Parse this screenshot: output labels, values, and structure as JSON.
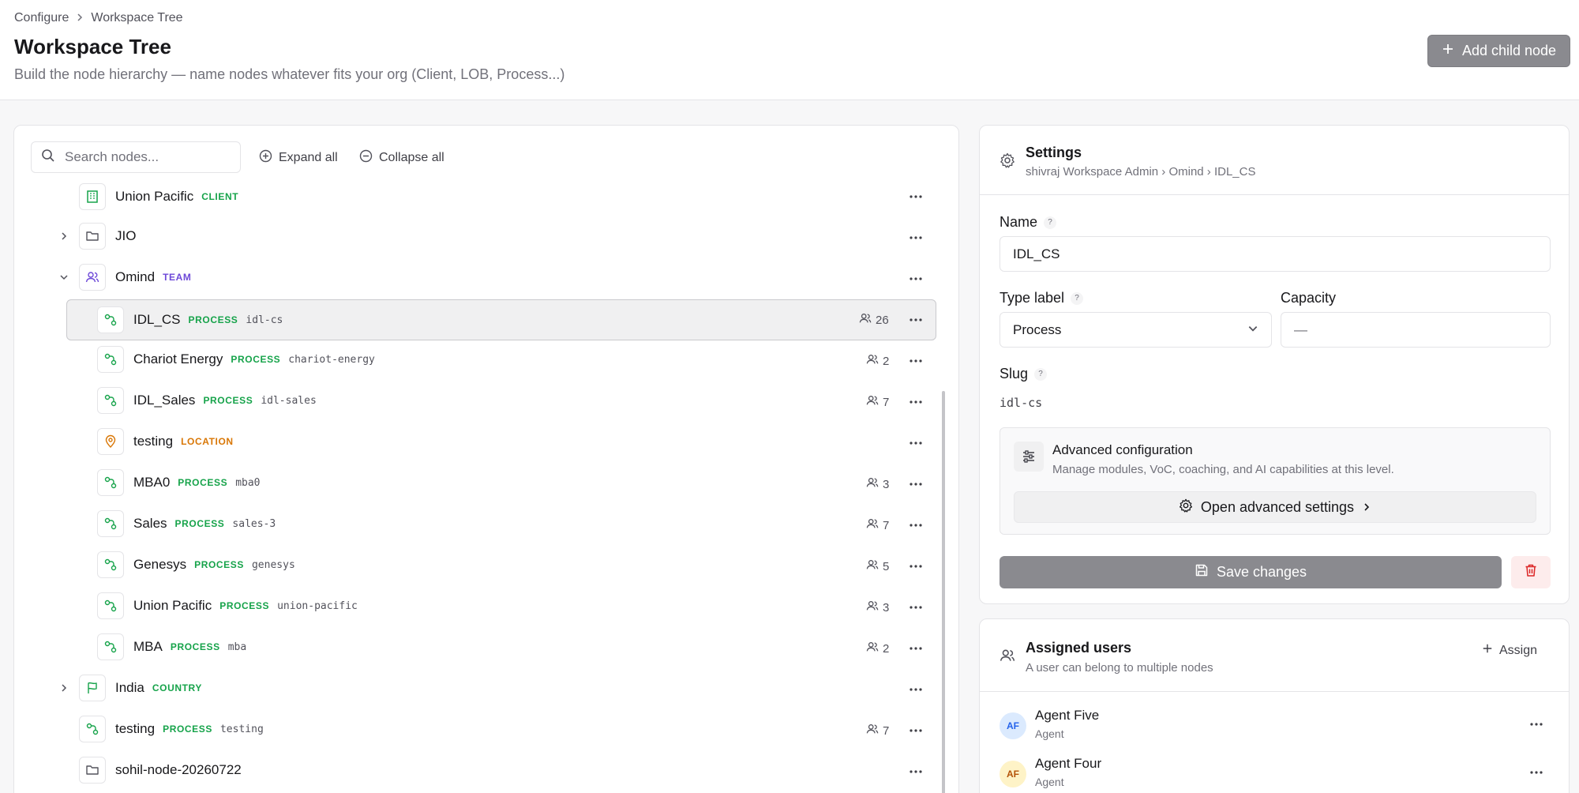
{
  "header": {
    "breadcrumb": [
      "Configure",
      "Workspace Tree"
    ],
    "title": "Workspace Tree",
    "subtitle": "Build the node hierarchy — name nodes whatever fits your org (Client, LOB, Process...)",
    "add_child_label": "Add child node"
  },
  "tree": {
    "search_placeholder": "Search nodes...",
    "expand_all": "Expand all",
    "collapse_all": "Collapse all",
    "nodes": [
      {
        "name": "Union Pacific",
        "type": "CLIENT",
        "slug": "",
        "count": ""
      },
      {
        "name": "JIO",
        "type": "",
        "slug": "",
        "count": ""
      },
      {
        "name": "Omind",
        "type": "TEAM",
        "slug": "",
        "count": ""
      },
      {
        "name": "IDL_CS",
        "type": "PROCESS",
        "slug": "idl-cs",
        "count": "26"
      },
      {
        "name": "Chariot Energy",
        "type": "PROCESS",
        "slug": "chariot-energy",
        "count": "2"
      },
      {
        "name": "IDL_Sales",
        "type": "PROCESS",
        "slug": "idl-sales",
        "count": "7"
      },
      {
        "name": "testing",
        "type": "LOCATION",
        "slug": "",
        "count": ""
      },
      {
        "name": "MBA0",
        "type": "PROCESS",
        "slug": "mba0",
        "count": "3"
      },
      {
        "name": "Sales",
        "type": "PROCESS",
        "slug": "sales-3",
        "count": "7"
      },
      {
        "name": "Genesys",
        "type": "PROCESS",
        "slug": "genesys",
        "count": "5"
      },
      {
        "name": "Union Pacific",
        "type": "PROCESS",
        "slug": "union-pacific",
        "count": "3"
      },
      {
        "name": "MBA",
        "type": "PROCESS",
        "slug": "mba",
        "count": "2"
      },
      {
        "name": "India",
        "type": "COUNTRY",
        "slug": "",
        "count": ""
      },
      {
        "name": "testing",
        "type": "PROCESS",
        "slug": "testing",
        "count": "7"
      },
      {
        "name": "sohil-node-20260722",
        "type": "",
        "slug": "",
        "count": ""
      }
    ]
  },
  "settings": {
    "title": "Settings",
    "path": "shivraj Workspace Admin › Omind › IDL_CS",
    "name_label": "Name",
    "name_value": "IDL_CS",
    "type_label": "Type label",
    "type_value": "Process",
    "capacity_label": "Capacity",
    "capacity_value": "—",
    "slug_label": "Slug",
    "slug_value": "idl-cs",
    "advanced_title": "Advanced configuration",
    "advanced_desc": "Manage modules, VoC, coaching, and AI capabilities at this level.",
    "advanced_btn": "Open advanced settings",
    "save_label": "Save changes"
  },
  "users": {
    "title": "Assigned users",
    "subtitle": "A user can belong to multiple nodes",
    "assign_label": "Assign",
    "list": [
      {
        "initials": "AF",
        "name": "Agent Five",
        "role": "Agent"
      },
      {
        "initials": "AF",
        "name": "Agent Four",
        "role": "Agent"
      }
    ]
  },
  "colors": {
    "process": "#16a34a",
    "team": "#6d48d8",
    "location": "#d97706",
    "primary_button": "#8a8a8f",
    "delete": "#dc2626"
  }
}
